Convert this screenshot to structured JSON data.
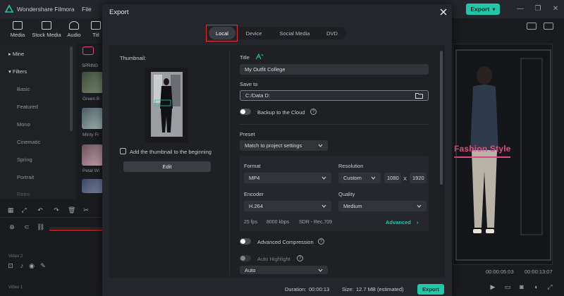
{
  "app": {
    "name": "Wondershare Filmora",
    "menu_file": "File",
    "export_label": "Export"
  },
  "toolbar": {
    "items": [
      "Media",
      "Stock Media",
      "Audio",
      "Titl"
    ]
  },
  "left_panel": {
    "categories": [
      "Mine",
      "Filters",
      "Basic",
      "Featured",
      "Mono",
      "Cinematic",
      "Spring",
      "Portrait",
      "Retro"
    ],
    "section_label": "SPRING",
    "thumbs": [
      "Green B",
      "Minty Fr",
      "Petal Wi"
    ]
  },
  "timeline": {
    "track_a": "Video 2",
    "track_b": "Video 1"
  },
  "preview": {
    "overlay_text": "Fashion Style",
    "time_current": "00:00:05:03",
    "time_total": "00:00:13:07"
  },
  "export_dialog": {
    "title": "Export",
    "tabs": [
      "Local",
      "Device",
      "Social Media",
      "DVD"
    ],
    "active_tab": "Local",
    "thumbnail_label": "Thumbnail:",
    "add_thumbnail_label": "Add the thumbnail to the beginning",
    "edit_label": "Edit",
    "title_label": "Title",
    "title_value": "My Outfit College",
    "save_to_label": "Save to",
    "save_to_value": "C:/Data D:",
    "backup_label": "Backup to the Cloud",
    "preset_label": "Preset",
    "preset_value": "Match to project settings",
    "format_label": "Format",
    "format_value": "MP4",
    "resolution_label": "Resolution",
    "resolution_value": "Custom",
    "res_width": "1080",
    "res_x": "X",
    "res_height": "1920",
    "encoder_label": "Encoder",
    "encoder_value": "H.264",
    "quality_label": "Quality",
    "quality_value": "Medium",
    "spec_fps": "25 fps",
    "spec_bitrate": "8000 kbps",
    "spec_color": "SDR - Rec.709",
    "advanced_label": "Advanced",
    "advanced_compression_label": "Advanced Compression",
    "auto_highlight_label": "Auto Highlight",
    "auto_value": "Auto",
    "duration_label": "Duration:",
    "duration_value": "00:00:13",
    "size_label": "Size:",
    "size_value": "12.7 MB (estimated)",
    "export_label": "Export"
  },
  "colors": {
    "accent": "#1fc8a8",
    "highlight": "#e0303a",
    "overlay_pink": "#e04a82"
  }
}
